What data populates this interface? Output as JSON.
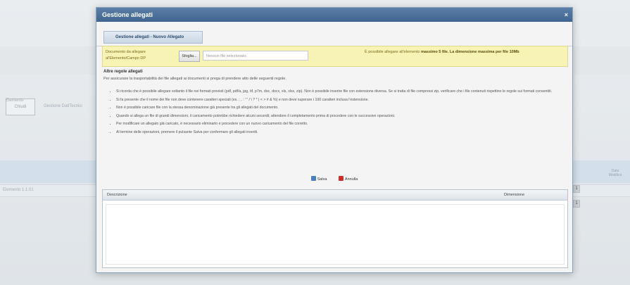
{
  "modal": {
    "title": "Gestione allegati",
    "close": "×",
    "tab": "Gestione allegati - Nuovo Allegato"
  },
  "upload": {
    "label": "Documento da allegare al'Elemento/Campo DP",
    "button": "Sfoglia...",
    "placeholder": "Nessun file selezionato.",
    "note_prefix": "È possibile allegare all'elemento ",
    "note_bold": "massimo 5 file. La dimensione massima per file 10Mb"
  },
  "info": {
    "title": "Altre regole allegati",
    "intro": "Per assicurare la trasportabilità dei file allegati ai documenti si prega di prendere atto delle seguenti regole.",
    "bullets": [
      "Si ricorda che è possibile allegare soltanto il file nei formati previsti (pdf, pdf/a, jpg, tif, p7m, doc, docx, xls, xlsx, zip). Non è possibile inserire file con estensione diversa. Se si tratta di file compressi zip, verificare che i file contenuti rispettino le regole sui formati consentiti.",
      "Si fa presente che il nome dei file non deve contenere caratteri speciali (es. ; , : ' \" / \\ ? * | < > # & %) e non deve superare i 100 caratteri inclusa l'estensione.",
      "Non è possibile caricare file con la stessa denominazione già presente tra gli allegati del documento.",
      "Quando si allega un file di grandi dimensioni, il caricamento potrebbe richiedere alcuni secondi; attendere il completamento prima di procedere con le successive operazioni.",
      "Per modificare un allegato già caricato, è necessario eliminarlo e procedere con un nuovo caricamento del file corretto.",
      "Al termine delle operazioni, premere il pulsante Salva per confermare gli allegati inseriti."
    ]
  },
  "actions": {
    "save": "Salva",
    "cancel": "Annulla"
  },
  "table": {
    "col_desc": "Descrizione",
    "col_size": "Dimensione"
  },
  "background": {
    "tab": "Chiudi",
    "breadcrumb": "Gestione DatiTecnici",
    "left_label": "Elemento",
    "right_text": "Data Modifica",
    "row_label": "Elemento 1.1.01",
    "box1": "1",
    "box2": "1"
  }
}
